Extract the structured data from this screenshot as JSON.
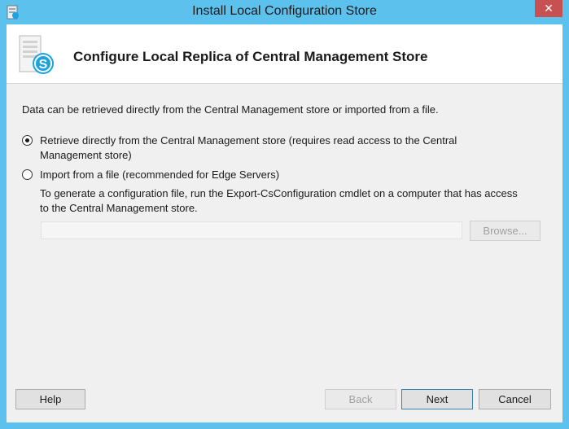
{
  "window": {
    "title": "Install Local Configuration Store",
    "close_label": "✕"
  },
  "header": {
    "title": "Configure Local Replica of Central Management Store"
  },
  "content": {
    "intro": "Data can be retrieved directly from the Central Management store or imported from a file.",
    "option_retrieve": {
      "label": "Retrieve directly from the Central Management store (requires read access to the Central Management store)",
      "selected": true
    },
    "option_import": {
      "label": "Import from a file (recommended for Edge Servers)",
      "selected": false
    },
    "import_description": "To generate a configuration file, run the Export-CsConfiguration cmdlet on a computer that has access to the Central Management store.",
    "file_path_value": "",
    "browse_label": "Browse..."
  },
  "footer": {
    "help_label": "Help",
    "back_label": "Back",
    "next_label": "Next",
    "cancel_label": "Cancel"
  },
  "colors": {
    "titlebar": "#5cc1ec",
    "close": "#c75050",
    "skype_blue": "#1aa3e0"
  },
  "icons": {
    "app": "app-icon",
    "header": "skype-server-icon"
  }
}
